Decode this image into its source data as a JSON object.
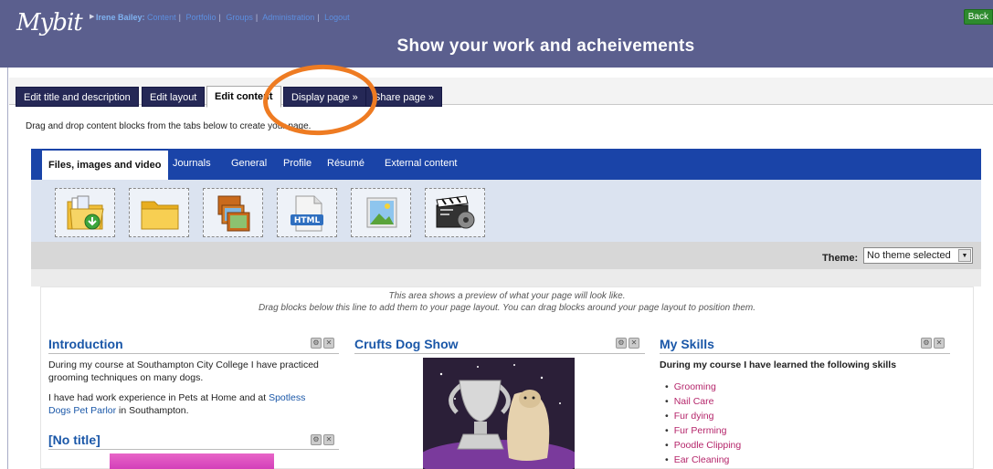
{
  "header": {
    "logo": "Mybit",
    "user": "Irene Bailey",
    "nav": [
      "Content",
      "Portfolio",
      "Groups",
      "Administration",
      "Logout"
    ],
    "back_label": "Back",
    "title": "Show your work and acheivements"
  },
  "edit_tabs": [
    {
      "label": "Edit title and description"
    },
    {
      "label": "Edit layout"
    },
    {
      "label": "Edit content"
    },
    {
      "label": "Display page »"
    },
    {
      "label": "Share page »"
    }
  ],
  "instructions": "Drag and drop content blocks from the tabs below to create your page.",
  "block_categories": [
    "Files, images and video",
    "Journals",
    "General",
    "Profile",
    "Résumé",
    "External content"
  ],
  "block_icons": [
    "file-download-folder-icon",
    "folder-icon",
    "image-gallery-icon",
    "html-file-icon",
    "image-icon",
    "video-clapper-icon"
  ],
  "theme": {
    "label": "Theme:",
    "selected": "No theme selected"
  },
  "preview": {
    "note_line1": "This area shows a preview of what your page will look like.",
    "note_line2": "Drag blocks below this line to add them to your page layout. You can drag blocks around your page layout to position them.",
    "introduction": {
      "title": "Introduction",
      "para1": "During my course at Southampton City College I have practiced grooming techniques on many dogs.",
      "para2_before": "I have had work experience in Pets at Home and  at ",
      "para2_link": "Spotless Dogs Pet Parlor",
      "para2_after": " in Southampton."
    },
    "no_title": {
      "title": "[No title]"
    },
    "crufts": {
      "title": "Crufts Dog Show"
    },
    "skills": {
      "title": "My Skills",
      "intro": "During my course I have learned the following skills",
      "items": [
        "Grooming",
        "Nail Care",
        "Fur dying",
        "Fur Perming",
        "Poodle Clipping",
        "Ear Cleaning"
      ]
    }
  },
  "colors": {
    "header_bg": "#5b5f8e",
    "tab_dark": "#252856",
    "category_bar": "#1a44a8",
    "highlight_circle": "#ee7b22",
    "link": "#1a57a8",
    "skill_link": "#b5266b"
  }
}
